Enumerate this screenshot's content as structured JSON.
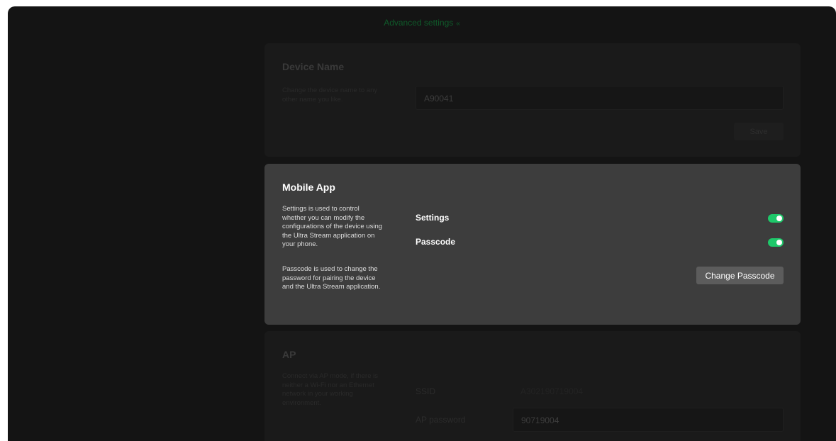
{
  "advanced_toggle": {
    "label": "Advanced settings",
    "chevron": "«"
  },
  "device_name_card": {
    "title": "Device Name",
    "description": "Change the device name to any other name you like.",
    "input_value": "A90041",
    "save_label": "Save"
  },
  "mobile_app_card": {
    "title": "Mobile App",
    "description_1": "Settings is used to control whether you can modify the configurations of the device using the Ultra Stream application on your phone.",
    "description_2": "Passcode is used to change the password for pairing the device and the Ultra Stream application.",
    "settings_label": "Settings",
    "settings_enabled": true,
    "passcode_label": "Passcode",
    "passcode_enabled": true,
    "change_passcode_label": "Change Passcode"
  },
  "ap_card": {
    "title": "AP",
    "description": "Connect via AP mode, if there is neither a Wi-Fi nor an Ethernet network in your working environment.",
    "ssid_label": "SSID",
    "ssid_value": "A302190719004",
    "ap_password_label": "AP password",
    "ap_password_value": "90719004"
  },
  "colors": {
    "accent_green": "#1ec86a",
    "advanced_link": "#0f5a2a",
    "active_card_bg": "#3d3d3d",
    "background": "#141414"
  }
}
